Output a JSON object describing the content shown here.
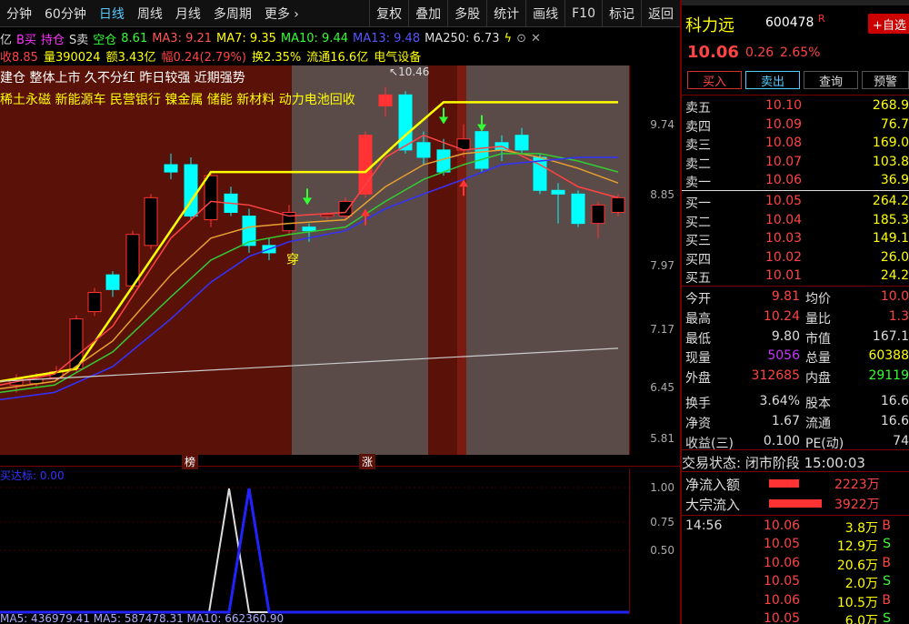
{
  "toolbar": {
    "periods": [
      "分钟",
      "60分钟",
      "日线",
      "周线",
      "月线",
      "多周期",
      "更多"
    ],
    "active_period": "日线",
    "tools": [
      "复权",
      "叠加",
      "多股",
      "统计",
      "画线",
      "F10",
      "标记",
      "返回"
    ]
  },
  "indicators": {
    "name": "亿",
    "b_buy": "B买",
    "hold": "持仓",
    "s_sell": "S卖",
    "empty": "空仓",
    "empty_value": "8.61",
    "ma3": "MA3: 9.21",
    "ma7": "MA7: 9.35",
    "ma10": "MA10: 9.44",
    "ma13": "MA13: 9.48",
    "ma250": "MA250: 6.73"
  },
  "subinfo": {
    "close": "收8.85",
    "volume": "量390024",
    "amount": "额3.43亿",
    "range": "幅0.24(2.79%)",
    "turnover": "换2.35%",
    "float": "流通16.6亿",
    "sector": "电气设备"
  },
  "tags_line1": "建仓  整体上市  久不分红  昨日较强  近期强势",
  "tags_line2": "稀土永磁  新能源车  民营银行  镍金属  储能  新材料  动力电池回收",
  "chart_marks": {
    "high_label": "10.46",
    "chuan": "穿",
    "bang": "榜",
    "zhang": "涨"
  },
  "price_ticks": [
    "9.74",
    "8.85",
    "7.97",
    "7.17",
    "6.45",
    "5.81"
  ],
  "sub_chart": {
    "title": "买达标: 0.00",
    "ticks": [
      "1.00",
      "0.75",
      "0.50"
    ]
  },
  "bottom_ma": "MA5: 436979.41   MA5: 587478.31   MA10: 662360.90",
  "stock": {
    "name": "科力远",
    "code": "600478",
    "mark": "R",
    "watch_button": "+自选",
    "price": "10.06",
    "change": "0.26",
    "change_pct": "2.65%",
    "buy_button": "买入",
    "sell_button": "卖出",
    "query_button": "查询",
    "alert_button": "预警"
  },
  "order_book": {
    "sells": [
      {
        "label": "卖五",
        "price": "10.10",
        "vol": "268.9"
      },
      {
        "label": "卖四",
        "price": "10.09",
        "vol": "76.7"
      },
      {
        "label": "卖三",
        "price": "10.08",
        "vol": "169.0"
      },
      {
        "label": "卖二",
        "price": "10.07",
        "vol": "103.8"
      },
      {
        "label": "卖一",
        "price": "10.06",
        "vol": "36.9"
      }
    ],
    "buys": [
      {
        "label": "买一",
        "price": "10.05",
        "vol": "264.2"
      },
      {
        "label": "买二",
        "price": "10.04",
        "vol": "185.3"
      },
      {
        "label": "买三",
        "price": "10.03",
        "vol": "149.1"
      },
      {
        "label": "买四",
        "price": "10.02",
        "vol": "26.0"
      },
      {
        "label": "买五",
        "price": "10.01",
        "vol": "24.2"
      }
    ]
  },
  "quote": [
    {
      "l1": "今开",
      "v1": "9.81",
      "c1": "#f44",
      "l2": "均价",
      "v2": "10.0",
      "c2": "#f44"
    },
    {
      "l1": "最高",
      "v1": "10.24",
      "c1": "#f44",
      "l2": "量比",
      "v2": "1.3",
      "c2": "#f44"
    },
    {
      "l1": "最低",
      "v1": "9.80",
      "c1": "#ddd",
      "l2": "市值",
      "v2": "167.1",
      "c2": "#ddd"
    },
    {
      "l1": "现量",
      "v1": "5056",
      "c1": "#c3f",
      "l2": "总量",
      "v2": "60388",
      "c2": "#ff0"
    },
    {
      "l1": "外盘",
      "v1": "312685",
      "c1": "#f44",
      "l2": "内盘",
      "v2": "29119",
      "c2": "#3f3"
    },
    {
      "l1": "换手",
      "v1": "3.64%",
      "c1": "#ddd",
      "l2": "股本",
      "v2": "16.6",
      "c2": "#ddd"
    },
    {
      "l1": "净资",
      "v1": "1.67",
      "c1": "#ddd",
      "l2": "流通",
      "v2": "16.6",
      "c2": "#ddd"
    },
    {
      "l1": "收益(三)",
      "v1": "0.100",
      "c1": "#ddd",
      "l2": "PE(动)",
      "v2": "74",
      "c2": "#ddd"
    }
  ],
  "trade_status": "交易状态: 闭市阶段 15:00:03",
  "flows": [
    {
      "label": "净流入额",
      "value": "2223万",
      "level": 0.57
    },
    {
      "label": "大宗流入",
      "value": "3922万",
      "level": 1.0
    }
  ],
  "ticks": [
    {
      "time": "14:56",
      "price": "10.06",
      "vol": "3.8万",
      "side": "B"
    },
    {
      "time": "",
      "price": "10.05",
      "vol": "12.9万",
      "side": "S"
    },
    {
      "time": "",
      "price": "10.06",
      "vol": "20.6万",
      "side": "B"
    },
    {
      "time": "",
      "price": "10.05",
      "vol": "2.0万",
      "side": "S"
    },
    {
      "time": "",
      "price": "10.06",
      "vol": "10.5万",
      "side": "B"
    },
    {
      "time": "",
      "price": "10.05",
      "vol": "6.0万",
      "side": "S"
    }
  ],
  "colors": {
    "up": "#ff3333",
    "down": "#00ffff",
    "ma_yellow": "#ffff00",
    "ma_red": "#ff4444",
    "ma_green": "#33cc33",
    "ma_blue": "#3333ff",
    "bg_red_zone": "#5a1208",
    "bg_gray_zone": "#5a4a48"
  }
}
